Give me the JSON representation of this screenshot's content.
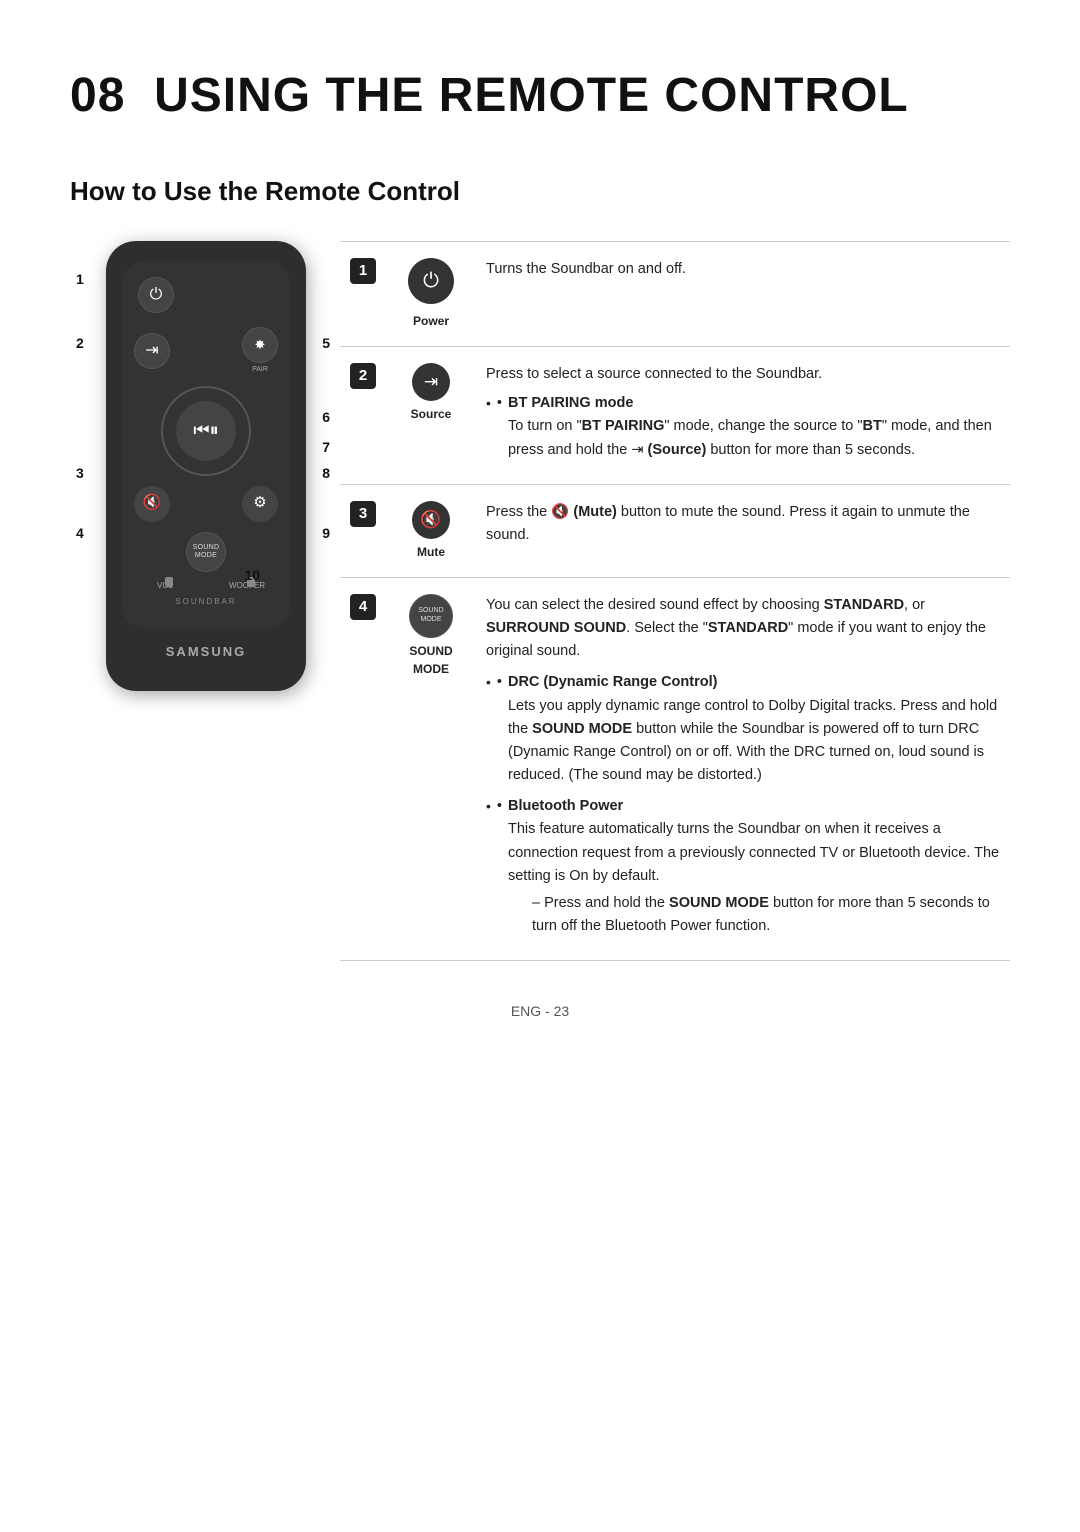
{
  "page": {
    "chapter": "08",
    "title": "USING THE REMOTE CONTROL",
    "section": "How to Use the Remote Control",
    "page_num": "ENG - 23"
  },
  "remote": {
    "samsung_label": "SAMSUNG",
    "soundbar_label": "SOUNDBAR",
    "vol_label": "VOL",
    "woofer_label": "WOOFER",
    "pair_label": "PAIR",
    "sound_mode_line1": "SOUND",
    "sound_mode_line2": "MODE"
  },
  "functions": [
    {
      "num": "1",
      "icon_type": "power",
      "icon_label": "Power",
      "description": "Turns the Soundbar on and off."
    },
    {
      "num": "2",
      "icon_type": "source",
      "icon_label": "Source",
      "description_parts": [
        {
          "type": "text",
          "text": "Press to select a source connected to the Soundbar."
        },
        {
          "type": "bullet_head",
          "text": "BT PAIRING mode"
        },
        {
          "type": "bullet_body",
          "text": "To turn on \"BT PAIRING\" mode, change the source to \"BT\" mode, and then press and hold the (Source) button for more than 5 seconds."
        }
      ]
    },
    {
      "num": "3",
      "icon_type": "mute",
      "icon_label": "Mute",
      "description": "Press the (Mute) button to mute the sound. Press it again to unmute the sound."
    },
    {
      "num": "4",
      "icon_type": "sound_mode",
      "icon_label": "SOUND MODE",
      "description_parts": [
        {
          "type": "text",
          "text": "You can select the desired sound effect by choosing STANDARD, or SURROUND SOUND. Select the \"STANDARD\" mode if you want to enjoy the original sound."
        },
        {
          "type": "bullet_head",
          "text": "DRC (Dynamic Range Control)"
        },
        {
          "type": "bullet_body",
          "text": "Lets you apply dynamic range control to Dolby Digital tracks. Press and hold the SOUND MODE button while the Soundbar is powered off to turn DRC (Dynamic Range Control) on or off. With the DRC turned on, loud sound is reduced. (The sound may be distorted.)"
        },
        {
          "type": "bullet_head",
          "text": "Bluetooth Power"
        },
        {
          "type": "bullet_body",
          "text": "This feature automatically turns the Soundbar on when it receives a connection request from a previously connected TV or Bluetooth device. The setting is On by default."
        },
        {
          "type": "dash",
          "text": "Press and hold the SOUND MODE button for more than 5 seconds to turn off the Bluetooth Power function."
        }
      ]
    }
  ]
}
